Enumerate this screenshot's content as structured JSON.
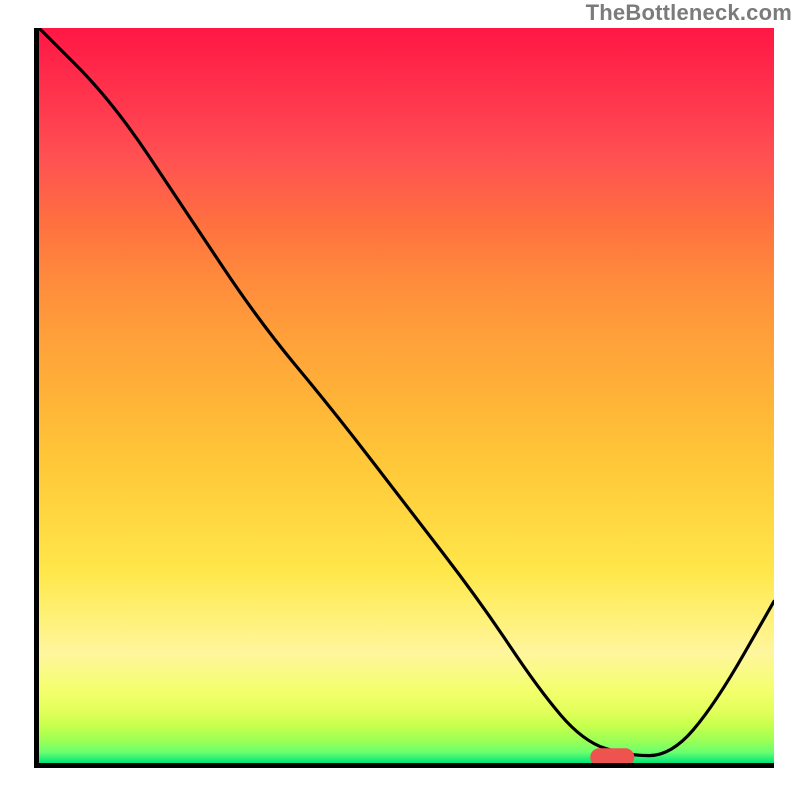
{
  "watermark": "TheBottleneck.com",
  "colors": {
    "gradient_top": "#ff1744",
    "gradient_bottom": "#00e676",
    "marker": "#ef5350",
    "axis": "#000000"
  },
  "chart_data": {
    "type": "line",
    "title": "",
    "xlabel": "",
    "ylabel": "",
    "xlim": [
      0,
      100
    ],
    "ylim": [
      0,
      100
    ],
    "x": [
      0,
      10,
      20,
      30,
      40,
      50,
      60,
      68,
      74,
      80,
      86,
      92,
      100
    ],
    "values": [
      100,
      90,
      75,
      60,
      48,
      35,
      22,
      10,
      3,
      1,
      1,
      8,
      22
    ],
    "marker": {
      "x_center": 78,
      "y": 0.8,
      "width": 6,
      "height": 2.4
    },
    "annotations": []
  }
}
